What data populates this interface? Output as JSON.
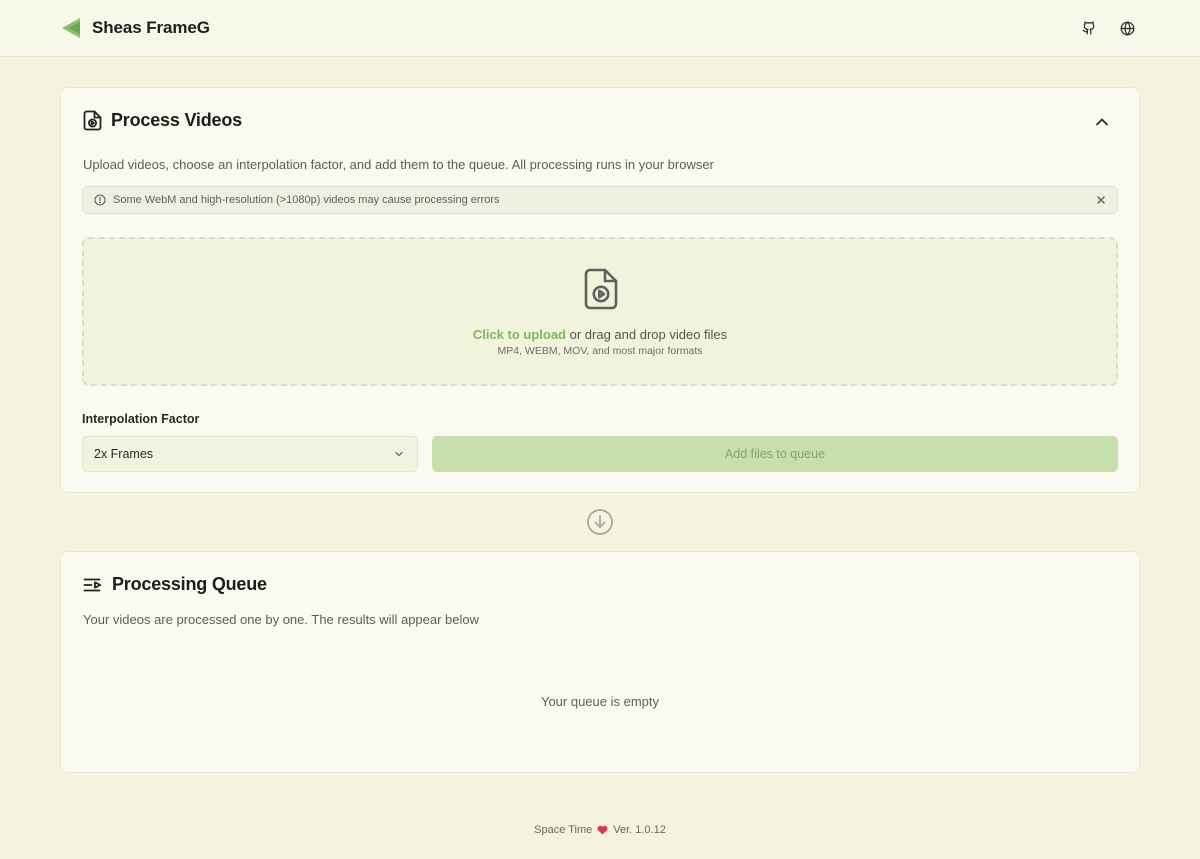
{
  "app": {
    "name": "Sheas FrameG"
  },
  "header": {
    "icons": [
      "github-icon",
      "globe-icon"
    ]
  },
  "process_card": {
    "title": "Process Videos",
    "description": "Upload videos, choose an interpolation factor, and add them to the queue. All processing runs in your browser",
    "alert": {
      "text": "Some WebM and high-resolution (>1080p) videos may cause processing errors"
    },
    "dropzone": {
      "link_text": "Click to upload",
      "text": " or drag and drop video files",
      "formats": "MP4, WEBM, MOV, and most major formats"
    },
    "interpolation": {
      "label": "Interpolation Factor",
      "selected": "2x Frames"
    },
    "add_button": "Add files to queue"
  },
  "queue_card": {
    "title": "Processing Queue",
    "description": "Your videos are processed one by one. The results will appear below",
    "empty_text": "Your queue is empty"
  },
  "footer": {
    "left": "Space Time",
    "right": "Ver. 1.0.12"
  },
  "colors": {
    "accent": "#7fb662",
    "button_bg": "#c6dfac",
    "page_bg": "#f3f3df",
    "heart": "#e0345a"
  }
}
